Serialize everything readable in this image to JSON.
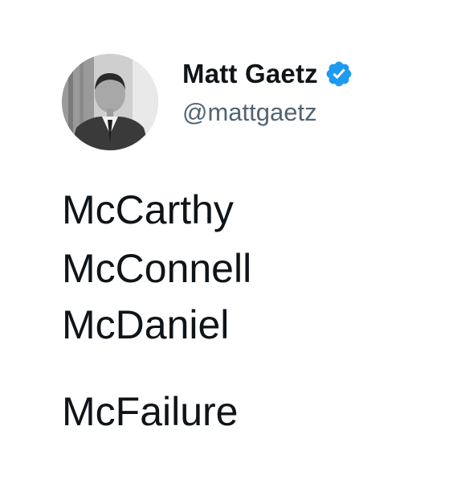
{
  "author": {
    "display_name": "Matt Gaetz",
    "handle": "@mattgaetz",
    "verified_icon": "verified-badge-icon",
    "verified_color": "#1d9bf0"
  },
  "tweet": {
    "lines": [
      "McCarthy",
      "McConnell",
      "McDaniel",
      "McFailure"
    ]
  },
  "colors": {
    "text": "#0f1419",
    "handle": "#536471",
    "background": "#ffffff"
  }
}
